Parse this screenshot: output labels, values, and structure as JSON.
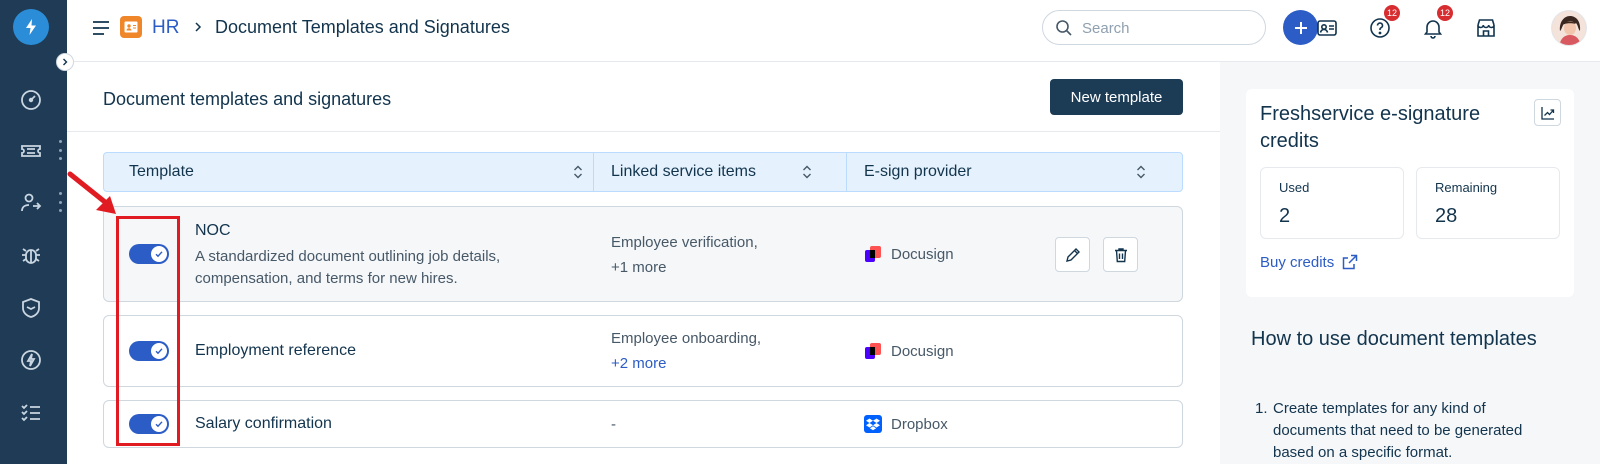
{
  "header": {
    "workspace": "HR",
    "title": "Document Templates and Signatures",
    "search_placeholder": "Search",
    "help_badge": "12",
    "notifications_badge": "12"
  },
  "main": {
    "title": "Document templates and signatures",
    "new_template_label": "New template",
    "columns": [
      "Template",
      "Linked service items",
      "E-sign provider"
    ],
    "rows": [
      {
        "name": "NOC",
        "description": "A standardized document outlining job details, compensation, and terms for new hires.",
        "linked_line1": "Employee verification,",
        "linked_line2": "+1 more",
        "provider": "Docusign",
        "enabled": true
      },
      {
        "name": "Employment reference",
        "description": "",
        "linked_line1": "Employee onboarding,",
        "linked_line2": "+2 more",
        "provider": "Docusign",
        "enabled": true
      },
      {
        "name": "Salary confirmation",
        "description": "",
        "linked_line1": "-",
        "linked_line2": "",
        "provider": "Dropbox",
        "enabled": true
      }
    ]
  },
  "credits": {
    "title": "Freshservice e-signature credits",
    "used_label": "Used",
    "used_value": "2",
    "remaining_label": "Remaining",
    "remaining_value": "28",
    "buy_label": "Buy credits"
  },
  "howto": {
    "title": "How to use document templates",
    "steps": [
      {
        "num": "1.",
        "text": "Create templates for any kind of documents that need to be generated based on a specific format."
      }
    ]
  },
  "colors": {
    "nav_bg": "#1f3b55",
    "accent": "#2c5cc5",
    "primary_button": "#1c3c56",
    "annotation": "#e11b22"
  }
}
